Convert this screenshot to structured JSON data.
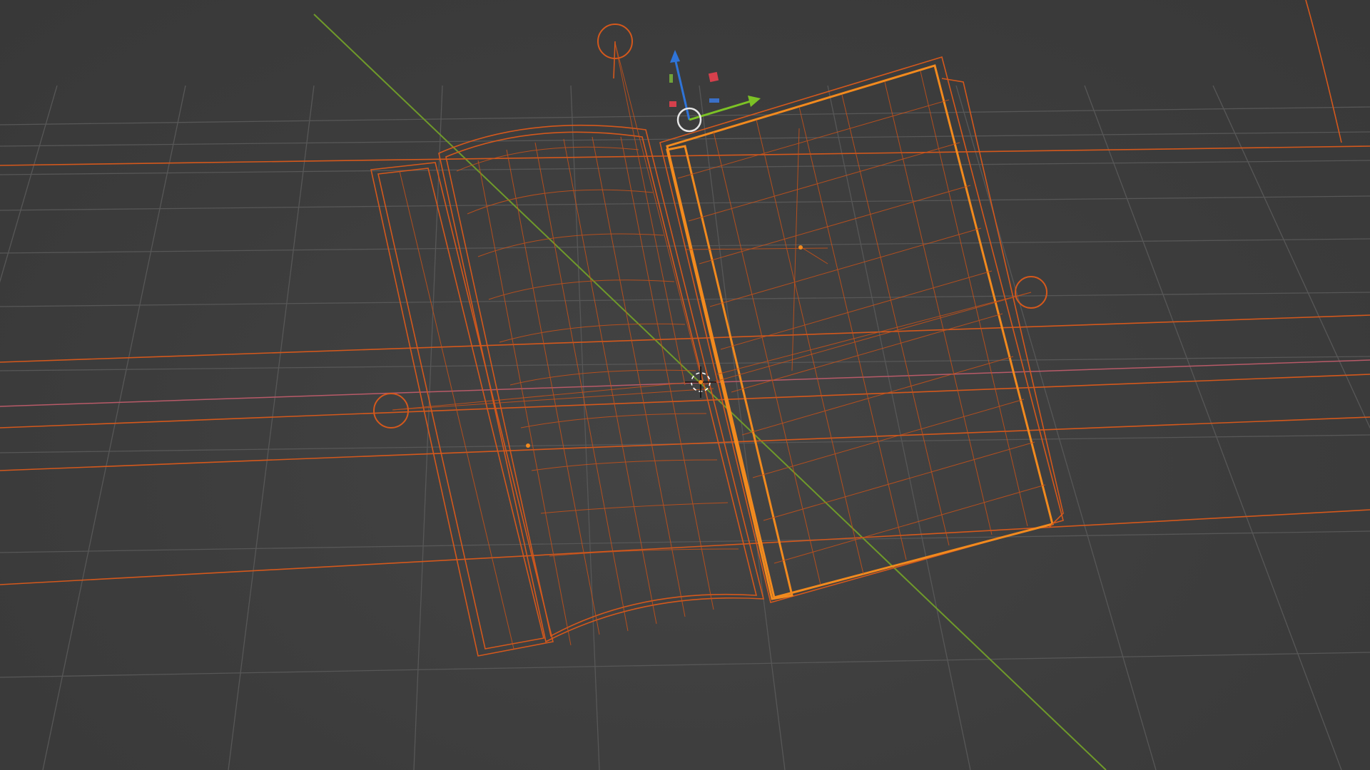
{
  "viewport": {
    "mode": "wireframe",
    "background": "#3d3d3d",
    "grid_color": "#575757",
    "selection_color": "#d4581c",
    "active_color": "#f28a1e",
    "axis_y_color": "#6f9a2a",
    "axis_x_color": "#b85a68"
  },
  "scene": {
    "object": "open-book",
    "selected": true,
    "lights": 3
  },
  "gizmo": {
    "x_color": "#7cc225",
    "y_color": "#8cc640",
    "z_color": "#2f74d8",
    "plane_xz_color": "#d6404c",
    "plane_yz_color": "#3a70c8",
    "plane_xy_color": "#6fa23a",
    "pivot_color": "#e6e6e6"
  }
}
